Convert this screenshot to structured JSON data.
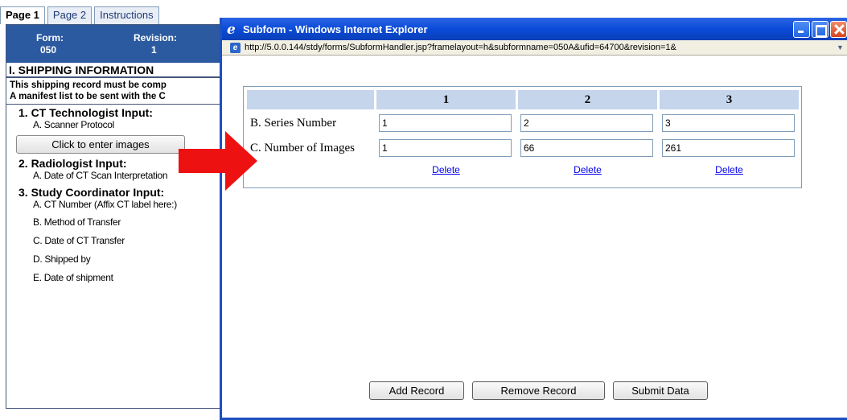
{
  "tabs": [
    {
      "label": "Page 1",
      "active": true
    },
    {
      "label": "Page 2",
      "active": false
    },
    {
      "label": "Instructions",
      "active": false
    }
  ],
  "form_header": {
    "form_label": "Form:",
    "form_value": "050",
    "revision_label": "Revision:",
    "revision_value": "1"
  },
  "form": {
    "section_title": "I. SHIPPING INFORMATION",
    "notice_line1": "This shipping record must be comp",
    "notice_line2": "A manifest list to be sent with the C",
    "subsections": {
      "ct_tech": "1. CT Technologist Input:",
      "radiologist": "2. Radiologist Input:",
      "coordinator": "3. Study Coordinator Input:"
    },
    "items": {
      "scanner_protocol": "A. Scanner Protocol",
      "enter_images_button": "Click to enter images",
      "date_ct_interpretation": "A. Date of CT Scan Interpretation",
      "ct_number": "A. CT Number (Affix CT label here:)",
      "method_transfer": "B. Method of Transfer",
      "date_ct_transfer": "C. Date of CT Transfer",
      "shipped_by": "D. Shipped by",
      "date_shipment": "E. Date of shipment"
    }
  },
  "popup": {
    "title": "Subform - Windows Internet Explorer",
    "url": "http://5.0.0.144/stdy/forms/SubformHandler.jsp?framelayout=h&subformname=050A&ufid=64700&revision=1&",
    "columns": [
      "1",
      "2",
      "3"
    ],
    "rows": [
      {
        "label": "B. Series Number",
        "values": [
          "1",
          "2",
          "3"
        ]
      },
      {
        "label": "C. Number of Images",
        "values": [
          "1",
          "66",
          "261"
        ]
      }
    ],
    "delete_label": "Delete",
    "buttons": {
      "add": "Add Record",
      "remove": "Remove Record",
      "submit": "Submit Data"
    }
  },
  "colors": {
    "form_header_bg": "#2c5aa0",
    "grid_header_bg": "#c5d5ec",
    "titlebar": "#0b4bd8",
    "arrow": "#ee1111"
  }
}
